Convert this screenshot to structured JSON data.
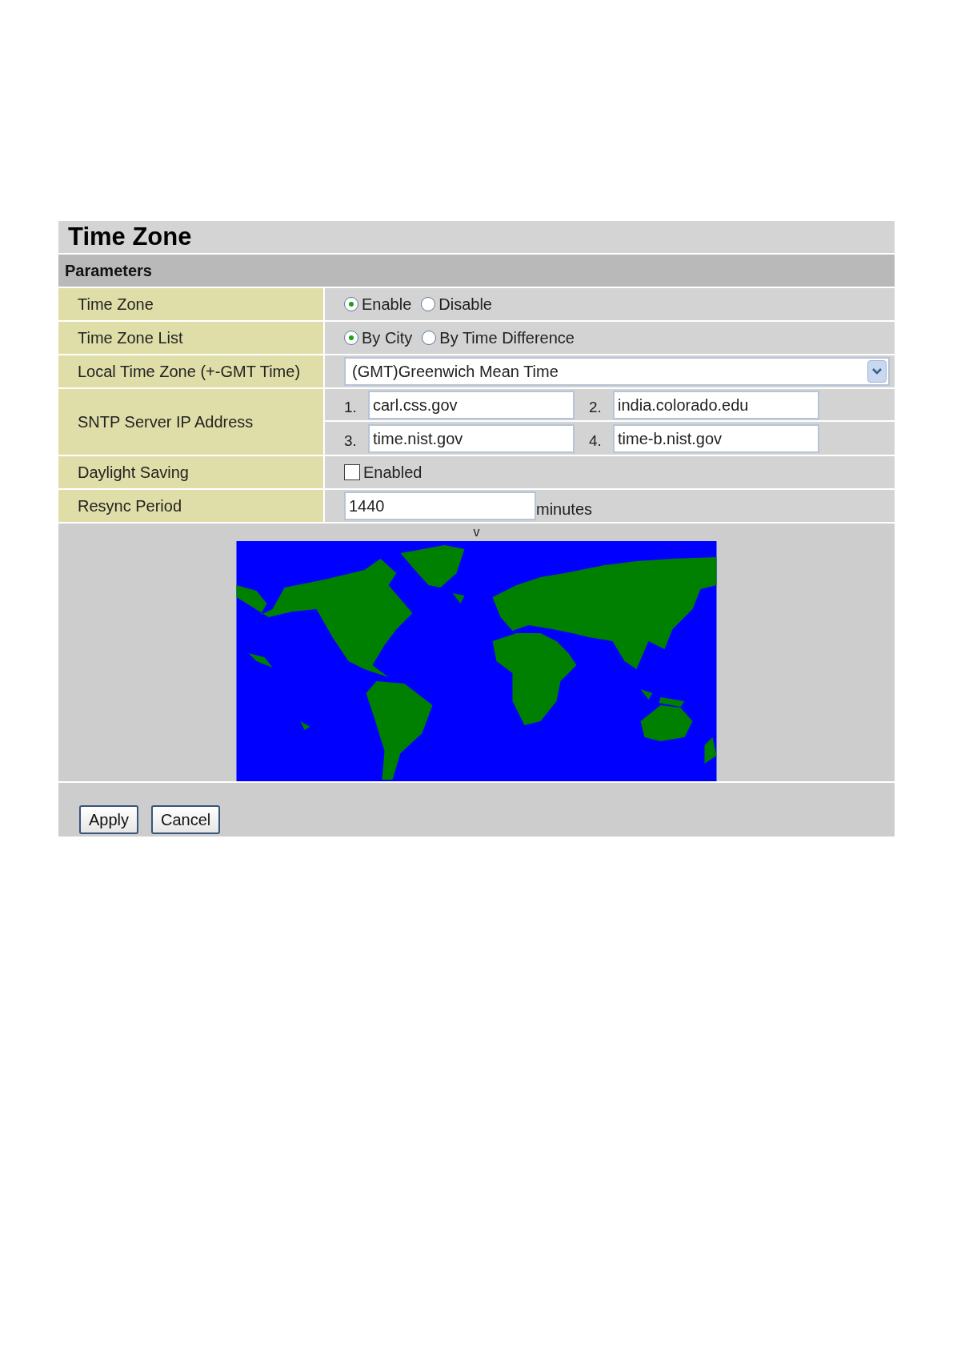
{
  "title": "Time Zone",
  "section": "Parameters",
  "rows": [
    {
      "kind": "radio",
      "label": "Time Zone",
      "options": [
        {
          "label": "Enable",
          "selected": true
        },
        {
          "label": "Disable",
          "selected": false
        }
      ]
    },
    {
      "kind": "radio",
      "label": "Time Zone List",
      "options": [
        {
          "label": "By City",
          "selected": true
        },
        {
          "label": "By Time Difference",
          "selected": false
        }
      ]
    },
    {
      "kind": "select",
      "label": "Local Time Zone (+-GMT Time)",
      "value": "(GMT)Greenwich Mean Time"
    },
    {
      "kind": "servers",
      "label": "SNTP Server IP Address",
      "servers": [
        {
          "number": "1.",
          "value": "carl.css.gov"
        },
        {
          "number": "2.",
          "value": "india.colorado.edu"
        },
        {
          "number": "3.",
          "value": "time.nist.gov"
        },
        {
          "number": "4.",
          "value": "time-b.nist.gov"
        }
      ]
    },
    {
      "kind": "checkbox",
      "label": "Daylight Saving",
      "option": "Enabled",
      "checked": false
    },
    {
      "kind": "text",
      "label": "Resync Period",
      "value": "1440",
      "unit": "minutes"
    }
  ],
  "map": {
    "marker": "v"
  },
  "buttons": [
    "Apply",
    "Cancel"
  ]
}
